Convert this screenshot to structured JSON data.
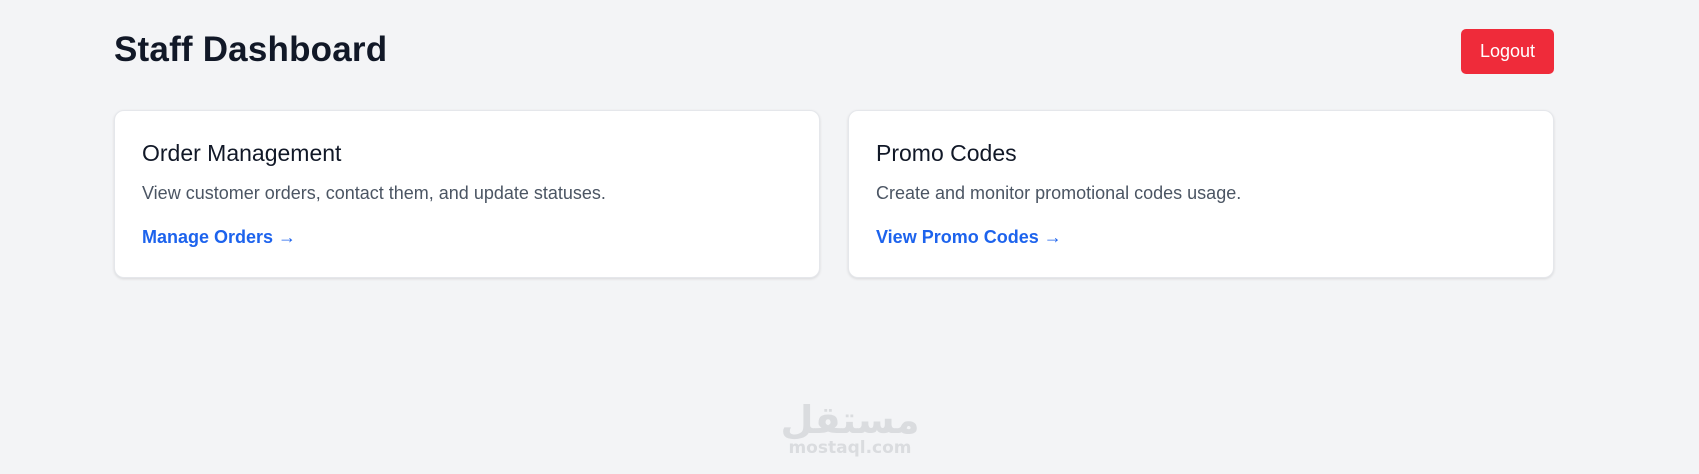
{
  "header": {
    "title": "Staff Dashboard",
    "logout_label": "Logout"
  },
  "cards": [
    {
      "title": "Order Management",
      "description": "View customer orders, contact them, and update statuses.",
      "link_label": "Manage Orders →"
    },
    {
      "title": "Promo Codes",
      "description": "Create and monitor promotional codes usage.",
      "link_label": "View Promo Codes →"
    }
  ],
  "watermark": {
    "arabic": "مستقل",
    "domain": "mostaql.com"
  },
  "colors": {
    "background": "#f3f4f6",
    "logout": "#ef2b3a",
    "link": "#1d63ed",
    "card": "#ffffff"
  }
}
